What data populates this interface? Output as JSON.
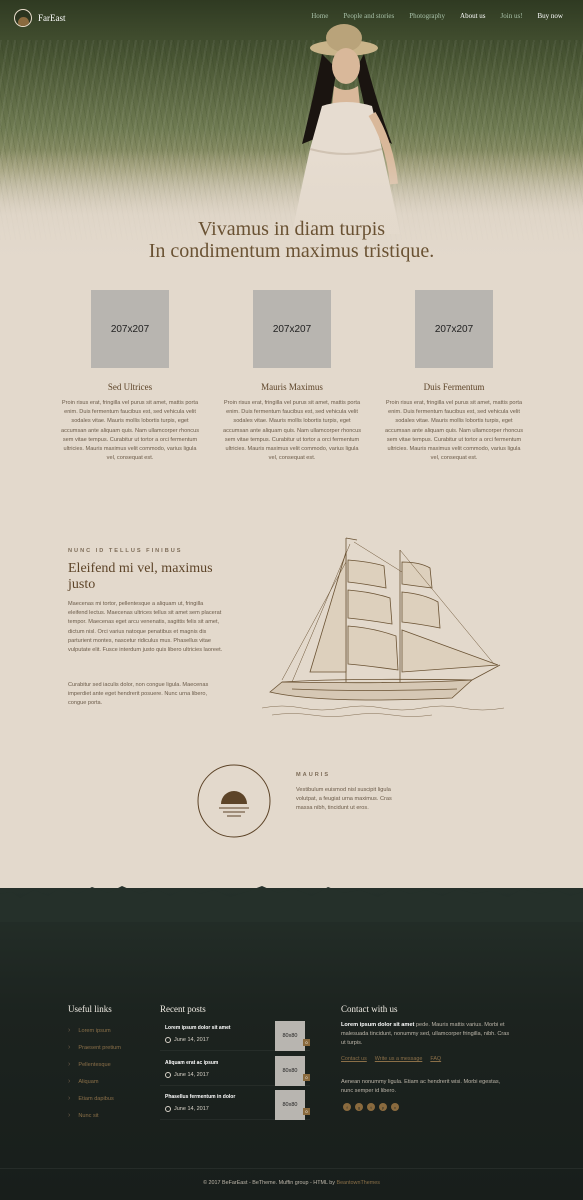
{
  "nav": {
    "logo_text": "FarEast",
    "items": [
      {
        "label": "Home"
      },
      {
        "label": "People and stories"
      },
      {
        "label": "Photography"
      },
      {
        "label": "About us"
      },
      {
        "label": "Join us!"
      },
      {
        "label": "Buy now"
      }
    ],
    "active_index": 3
  },
  "hero": {
    "title_line1": "Vivamus in diam turpis",
    "title_line2": "In condimentum maximus tristique."
  },
  "features": [
    {
      "image": "207x207",
      "title": "Sed Ultrices",
      "text": "Proin risus erat, fringilla vel purus sit amet, mattis porta enim. Duis fermentum faucibus est, sed vehicula velit sodales vitae. Mauris mollis lobortis turpis, eget accumsan ante aliquam quis. Nam ullamcorper rhoncus sem vitae tempus. Curabitur ut tortor a orci fermentum ultricies. Mauris maximus velit commodo, varius ligula vel, consequat est."
    },
    {
      "image": "207x207",
      "title": "Mauris Maximus",
      "text": "Proin risus erat, fringilla vel purus sit amet, mattis porta enim. Duis fermentum faucibus est, sed vehicula velit sodales vitae. Mauris mollis lobortis turpis, eget accumsan ante aliquam quis. Nam ullamcorper rhoncus sem vitae tempus. Curabitur ut tortor a orci fermentum ultricies. Mauris maximus velit commodo, varius ligula vel, consequat est."
    },
    {
      "image": "207x207",
      "title": "Duis Fermentum",
      "text": "Proin risus erat, fringilla vel purus sit amet, mattis porta enim. Duis fermentum faucibus est, sed vehicula velit sodales vitae. Mauris mollis lobortis turpis, eget accumsan ante aliquam quis. Nam ullamcorper rhoncus sem vitae tempus. Curabitur ut tortor a orci fermentum ultricies. Mauris maximus velit commodo, varius ligula vel, consequat est."
    }
  ],
  "about": {
    "kicker": "NUNC ID TELLUS FINIBUS",
    "heading": "Eleifend mi vel, maximus justo",
    "para1": "Maecenas mi tortor, pellentesque a aliquam ut, fringilla eleifend lectus. Maecenas ultrices tellus sit amet sem placerat tempor. Maecenas eget arcu venenatis, sagittis felis sit amet, dictum nisl. Orci varius natoque penatibus et magnis dis parturient montes, nascetur ridiculus mus. Phasellus vitae vulputate elit. Fusce interdum justo quis libero ultricies laoreet.",
    "para2": "Curabitur sed iaculis dolor, non congue ligula. Maecenas imperdiet ante eget hendrerit posuere. Nunc urna libero, congue porta."
  },
  "mauris": {
    "kicker": "MAURIS",
    "text": "Vestibulum euismod nisl suscipit ligula volutpat, a feugiat urna maximus. Cras massa nibh, tincidunt ut eros."
  },
  "footer": {
    "useful_links_title": "Useful links",
    "useful_links": [
      "Lorem ipsum",
      "Praesent pretium",
      "Pellentesque",
      "Aliquam",
      "Etiam dapibus",
      "Nunc sit"
    ],
    "recent_posts_title": "Recent posts",
    "posts": [
      {
        "title": "Lorem ipsum dolor sit amet",
        "date": "June 14, 2017",
        "thumb": "80x80",
        "badge": "0"
      },
      {
        "title": "Aliquam erat ac ipsum",
        "date": "June 14, 2017",
        "thumb": "80x80",
        "badge": "0"
      },
      {
        "title": "Phasellus fermentum in dolor",
        "date": "June 14, 2017",
        "thumb": "80x80",
        "badge": "0"
      }
    ],
    "contact_title": "Contact with us",
    "contact_bold": "Lorem ipsum dolor sit amet",
    "contact_text1": " pede. Mauris mattis varius. Morbi et malesuada tincidunt, nonummy sed, ullamcorper fringilla, nibh. Cras ut turpis.",
    "contact_links": [
      "Contact us",
      "Write us a message",
      "FAQ"
    ],
    "contact_text2": "Aenean nonummy ligula. Etiam ac hendrerit wisi. Morbi egestas, nunc semper id libero.",
    "socials": [
      "facebook-icon",
      "google-plus-icon",
      "twitter-icon",
      "pinterest-icon",
      "vimeo-icon"
    ],
    "copyright_prefix": "© 2017 BeFarEast - BeTheme. Muffin group - HTML by ",
    "copyright_link": "BeantownThemes"
  },
  "colors": {
    "background": "#e3d9cc",
    "heading_brown": "#5d4428",
    "accent_gold": "#8a6a3e",
    "footer_dark": "#1c231f"
  }
}
